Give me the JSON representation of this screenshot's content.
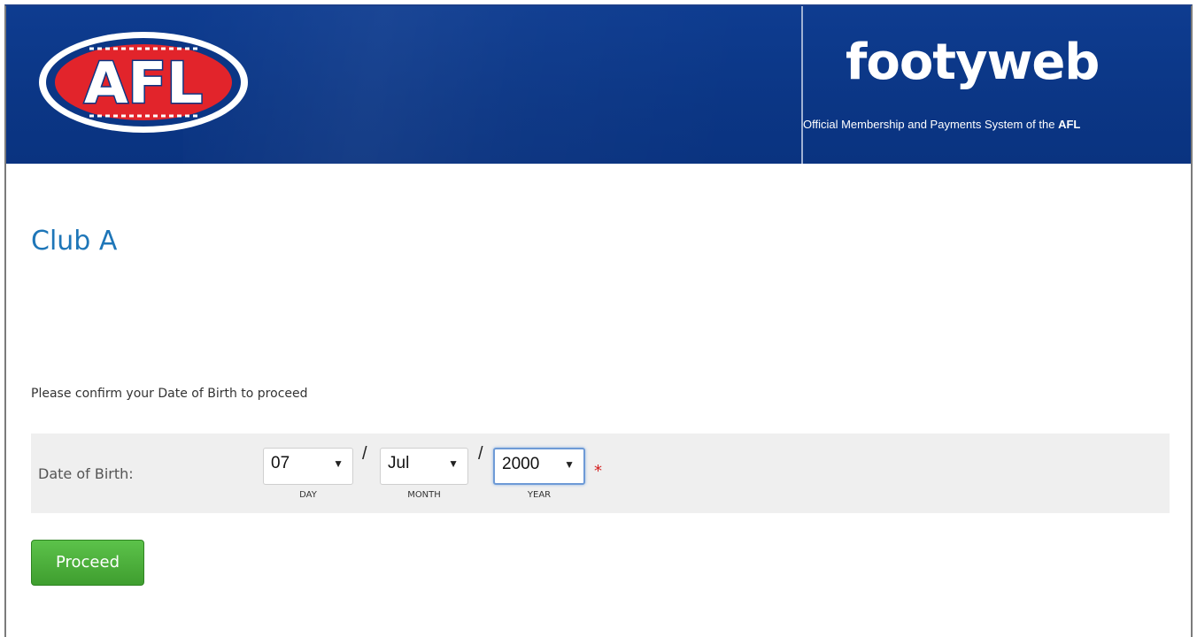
{
  "header": {
    "logo_text": "AFL",
    "brand_name": "footyweb",
    "tagline_prefix": "Official Membership and Payments System of the ",
    "tagline_bold": "AFL"
  },
  "page": {
    "club_title": "Club A",
    "intro_text": "Please confirm your Date of Birth to proceed"
  },
  "dob": {
    "label": "Date of Birth:",
    "day": {
      "value": "07",
      "sublabel": "DAY"
    },
    "month": {
      "value": "Jul",
      "sublabel": "MONTH"
    },
    "year": {
      "value": "2000",
      "sublabel": "YEAR"
    },
    "separator": "/",
    "required_marker": "*"
  },
  "actions": {
    "proceed_label": "Proceed"
  },
  "colors": {
    "header_blue": "#0b3685",
    "title_blue": "#1e76b8",
    "button_green": "#4caf3a",
    "required_red": "#d42020"
  }
}
